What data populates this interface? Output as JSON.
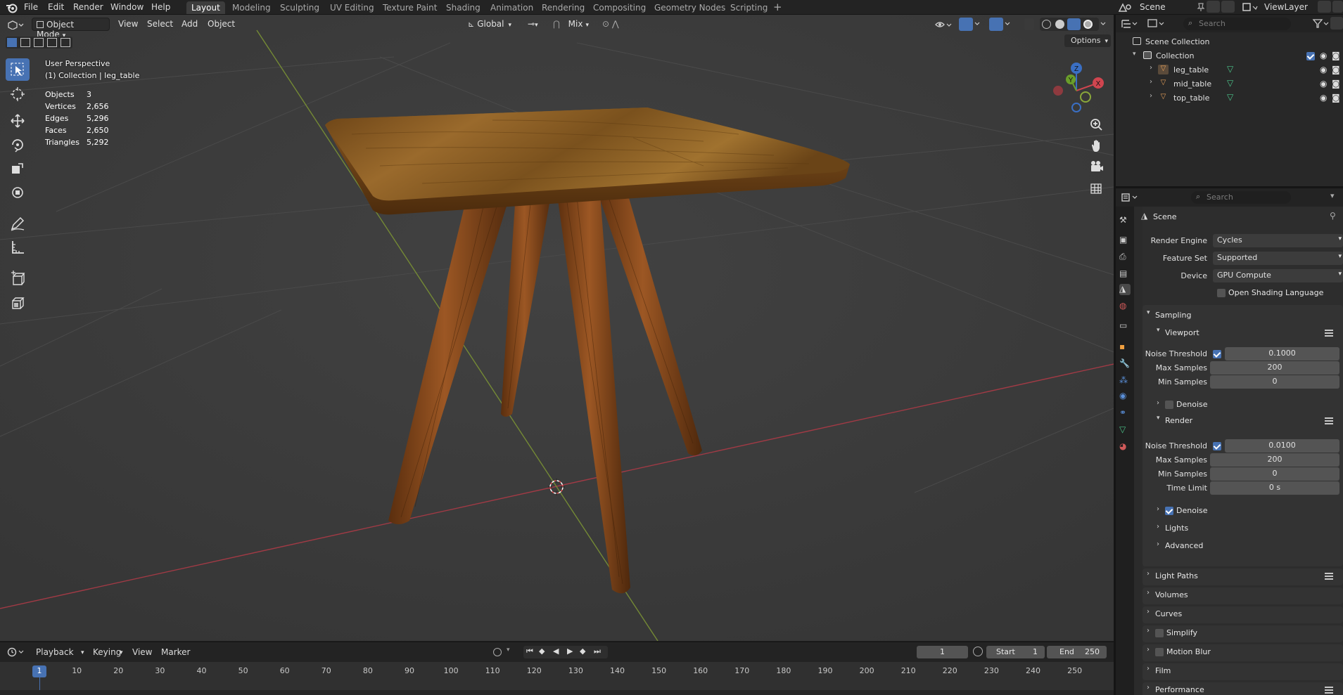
{
  "topbar": {
    "menus": [
      "File",
      "Edit",
      "Render",
      "Window",
      "Help"
    ],
    "workspaces": [
      "Layout",
      "Modeling",
      "Sculpting",
      "UV Editing",
      "Texture Paint",
      "Shading",
      "Animation",
      "Rendering",
      "Compositing",
      "Geometry Nodes",
      "Scripting"
    ],
    "active_workspace": "Layout",
    "scene": "Scene",
    "view_layer": "ViewLayer"
  },
  "viewport": {
    "mode": "Object Mode",
    "menus": [
      "View",
      "Select",
      "Add",
      "Object"
    ],
    "orientation": "Global",
    "snap_mix": "Mix",
    "options_label": "Options",
    "view_name": "User Perspective",
    "collection_info": "(1) Collection | leg_table",
    "stats": [
      {
        "label": "Objects",
        "value": "3"
      },
      {
        "label": "Vertices",
        "value": "2,656"
      },
      {
        "label": "Edges",
        "value": "5,296"
      },
      {
        "label": "Faces",
        "value": "2,650"
      },
      {
        "label": "Triangles",
        "value": "5,292"
      }
    ],
    "gizmo": {
      "x": "X",
      "y": "Y",
      "z": "Z"
    }
  },
  "timeline": {
    "menus": [
      "Playback",
      "Keying",
      "View",
      "Marker"
    ],
    "current_frame": "1",
    "start_label": "Start",
    "start": "1",
    "end_label": "End",
    "end": "250",
    "ticks": [
      "1",
      "10",
      "20",
      "30",
      "40",
      "50",
      "60",
      "70",
      "80",
      "90",
      "100",
      "110",
      "120",
      "130",
      "140",
      "150",
      "160",
      "170",
      "180",
      "190",
      "200",
      "210",
      "220",
      "230",
      "240",
      "250"
    ]
  },
  "outliner": {
    "search_placeholder": "Search",
    "scene_collection": "Scene Collection",
    "collection": "Collection",
    "objects": [
      "leg_table",
      "mid_table",
      "top_table"
    ]
  },
  "properties": {
    "search_placeholder": "Search",
    "context": "Scene",
    "render_engine_label": "Render Engine",
    "render_engine": "Cycles",
    "feature_set_label": "Feature Set",
    "feature_set": "Supported",
    "device_label": "Device",
    "device": "GPU Compute",
    "osl_label": "Open Shading Language",
    "sampling": "Sampling",
    "viewport_section": "Viewport",
    "noise_threshold_label": "Noise Threshold",
    "viewport_noise_threshold": "0.1000",
    "max_samples_label": "Max Samples",
    "viewport_max_samples": "200",
    "min_samples_label": "Min Samples",
    "viewport_min_samples": "0",
    "denoise_label": "Denoise",
    "render_section": "Render",
    "render_noise_threshold": "0.0100",
    "render_max_samples": "200",
    "render_min_samples": "0",
    "time_limit_label": "Time Limit",
    "time_limit": "0 s",
    "lights": "Lights",
    "advanced": "Advanced",
    "light_paths": "Light Paths",
    "volumes": "Volumes",
    "curves": "Curves",
    "simplify": "Simplify",
    "motion_blur": "Motion Blur",
    "film": "Film",
    "performance": "Performance"
  }
}
